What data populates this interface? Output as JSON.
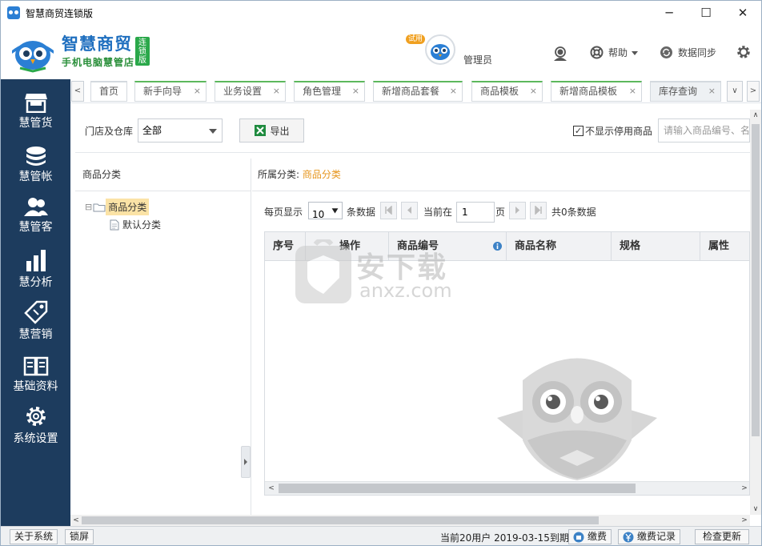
{
  "window": {
    "title": "智慧商贸连锁版",
    "minimize": "─",
    "maximize": "☐",
    "close": "✕"
  },
  "header": {
    "brand_name": "智慧商贸",
    "brand_slogan": "手机电脑慧管店",
    "brand_badge": "连锁版",
    "trial_badge": "试用",
    "user_name": "管理员",
    "help_label": "帮助",
    "sync_label": "数据同步"
  },
  "sidebar": {
    "items": [
      {
        "label": "慧管货",
        "icon": "store-icon"
      },
      {
        "label": "慧管帐",
        "icon": "coins-icon"
      },
      {
        "label": "慧管客",
        "icon": "users-icon"
      },
      {
        "label": "慧分析",
        "icon": "bar-chart-icon"
      },
      {
        "label": "慧营销",
        "icon": "tag-icon"
      },
      {
        "label": "基础资料",
        "icon": "book-icon"
      },
      {
        "label": "系统设置",
        "icon": "gear-icon"
      }
    ]
  },
  "tabs": [
    {
      "label": "首页"
    },
    {
      "label": "新手向导"
    },
    {
      "label": "业务设置"
    },
    {
      "label": "角色管理"
    },
    {
      "label": "新增商品套餐"
    },
    {
      "label": "商品模板"
    },
    {
      "label": "新增商品模板"
    },
    {
      "label": "库存查询"
    }
  ],
  "tab_close": "×",
  "toolbar": {
    "store_label": "门店及仓库",
    "store_value": "全部",
    "export_label": "导出",
    "hide_disabled_label": "不显示停用商品",
    "hide_disabled_checked": "✓",
    "search_placeholder": "请输入商品编号、名"
  },
  "category": {
    "header": "商品分类",
    "root": "商品分类",
    "child": "默认分类",
    "expander": "⊟"
  },
  "main": {
    "crumb_label": "所属分类:",
    "crumb_value": "商品分类",
    "pager": {
      "per_page_label": "每页显示",
      "per_page_value": "10",
      "per_page_unit": "条数据",
      "current_label": "当前在",
      "current_value": "1",
      "page_unit": "页",
      "total_text": "共0条数据"
    },
    "columns": [
      "序号",
      "操作",
      "商品编号",
      "商品名称",
      "规格",
      "属性"
    ]
  },
  "watermark": {
    "text": "安下载",
    "domain": "anxz.com"
  },
  "statusbar": {
    "about": "关于系统",
    "lock": "锁屏",
    "status_text": "当前20用户 2019-03-15到期",
    "pay": "缴费",
    "pay_records": "缴费记录",
    "check_update": "检查更新"
  },
  "colors": {
    "sidebar_bg": "#1d3c5e",
    "brand_blue": "#1f6fbf",
    "brand_green": "#2aa84a",
    "accent_orange": "#e6951c",
    "tab_green": "#5cb85c"
  }
}
